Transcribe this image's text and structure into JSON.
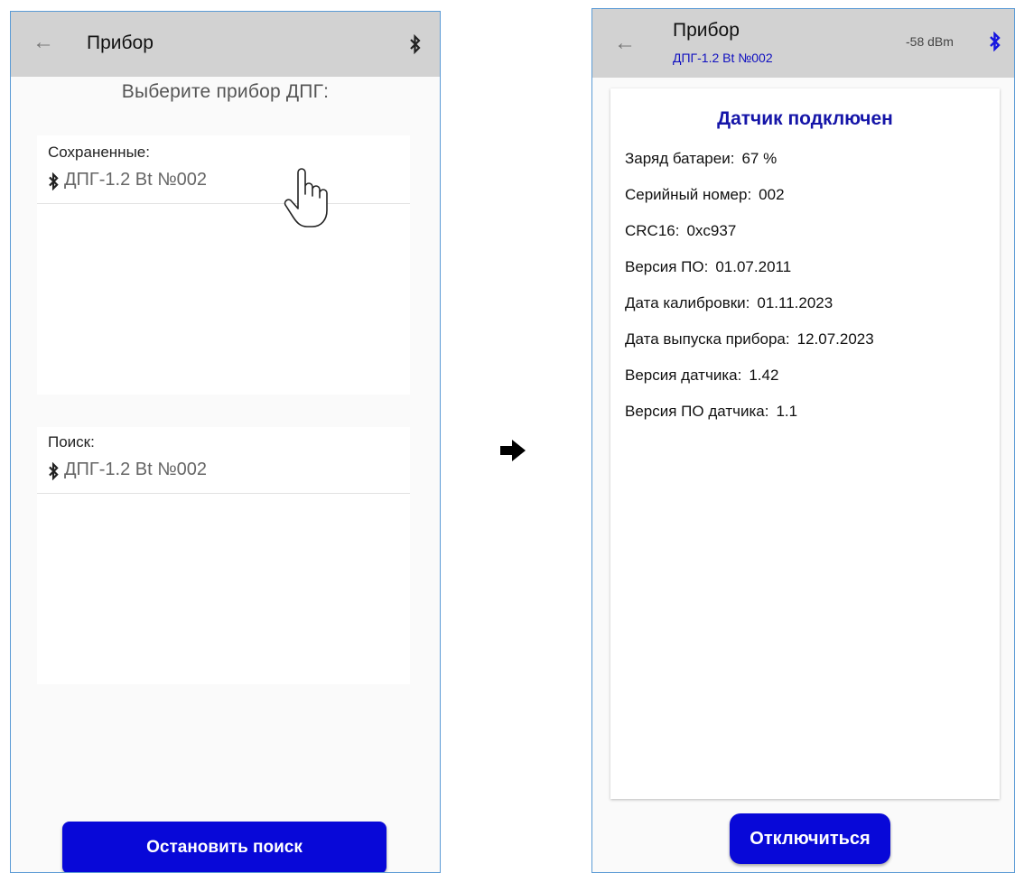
{
  "left_screen": {
    "appbar": {
      "back_icon": "arrow-left-icon",
      "title": "Прибор",
      "bt_icon": "bluetooth-icon"
    },
    "prompt": "Выберите прибор ДПГ:",
    "saved": {
      "label": "Сохраненные:",
      "devices": [
        "ДПГ-1.2 Bt №002"
      ]
    },
    "search": {
      "label": "Поиск:",
      "devices": [
        "ДПГ-1.2 Bt №002"
      ]
    },
    "stop_button": "Остановить поиск"
  },
  "arrow_icon": "arrow-right-icon",
  "right_screen": {
    "appbar": {
      "back_icon": "arrow-left-icon",
      "title": "Прибор",
      "subtitle": "ДПГ-1.2 Bt №002",
      "rssi": "-58 dBm",
      "bt_icon": "bluetooth-icon",
      "bt_color": "#1515e0"
    },
    "status": "Датчик подключен",
    "info": [
      {
        "label": "Заряд батареи:",
        "value": "67 %"
      },
      {
        "label": "Серийный номер:",
        "value": "002"
      },
      {
        "label": "CRC16:",
        "value": "0xc937"
      },
      {
        "label": "Версия ПО:",
        "value": "01.07.2011"
      },
      {
        "label": "Дата калибровки:",
        "value": "01.11.2023"
      },
      {
        "label": "Дата выпуска прибора:",
        "value": "12.07.2023"
      },
      {
        "label": "Версия датчика:",
        "value": "1.42"
      },
      {
        "label": "Версия ПО датчика:",
        "value": "1.1"
      }
    ],
    "disconnect_button": "Отключиться"
  },
  "colors": {
    "primary_button": "#0808d8",
    "appbar": "#d2d2d2",
    "accent_text": "#1515a8"
  }
}
